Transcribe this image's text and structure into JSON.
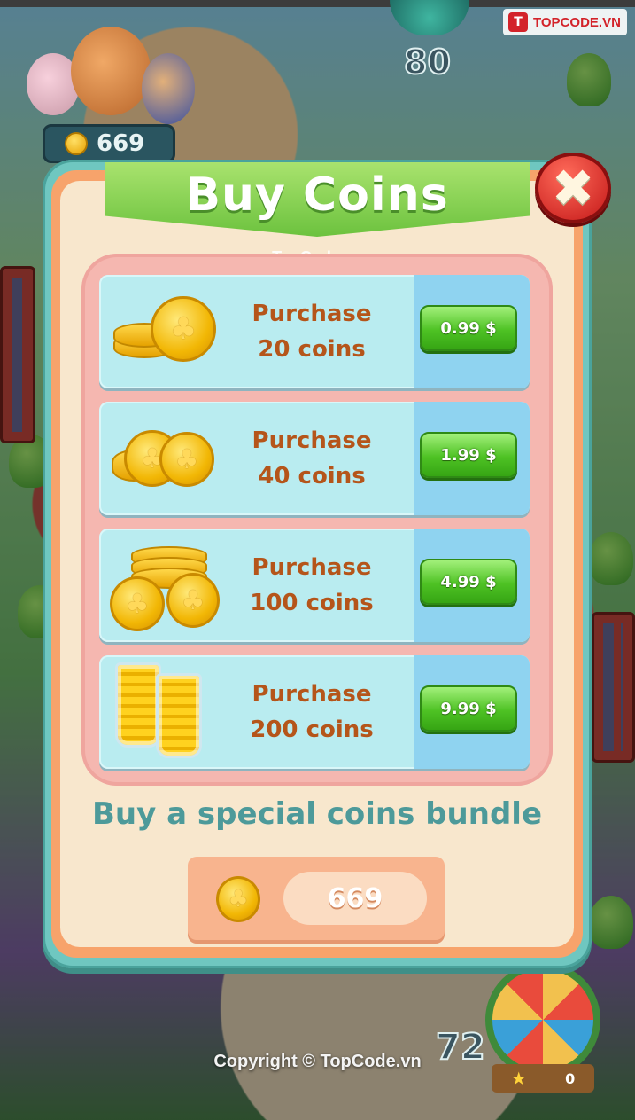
{
  "hud": {
    "coin_count": "669",
    "level_number": "80",
    "bottom_level_number": "72",
    "wheel_stars": "0"
  },
  "watermark": {
    "brand_top": "TOPCODE.VN",
    "brand_mid": "TopCode.vn",
    "copyright": "Copyright © TopCode.vn"
  },
  "modal": {
    "title": "Buy Coins",
    "close_icon": "✖",
    "packs": [
      {
        "line1": "Purchase",
        "line2": "20 coins",
        "price": "0.99 $",
        "icon": "coin-pile-small-icon"
      },
      {
        "line1": "Purchase",
        "line2": "40 coins",
        "price": "1.99 $",
        "icon": "coin-pile-medium-icon"
      },
      {
        "line1": "Purchase",
        "line2": "100 coins",
        "price": "4.99 $",
        "icon": "coin-pile-large-icon"
      },
      {
        "line1": "Purchase",
        "line2": "200 coins",
        "price": "9.99 $",
        "icon": "coin-glasses-icon"
      }
    ],
    "bundle_title": "Buy a special coins bundle",
    "balance": "669"
  },
  "colors": {
    "ribbon_green": "#6cc23e",
    "panel_pink": "#f5b7b0",
    "pack_bg": "#b9ecf0",
    "price_area": "#8fd3f0",
    "buy_button": "#4ec224",
    "label_brown": "#b5551a",
    "bundle_teal": "#4d9a9a",
    "close_red": "#c41818"
  }
}
